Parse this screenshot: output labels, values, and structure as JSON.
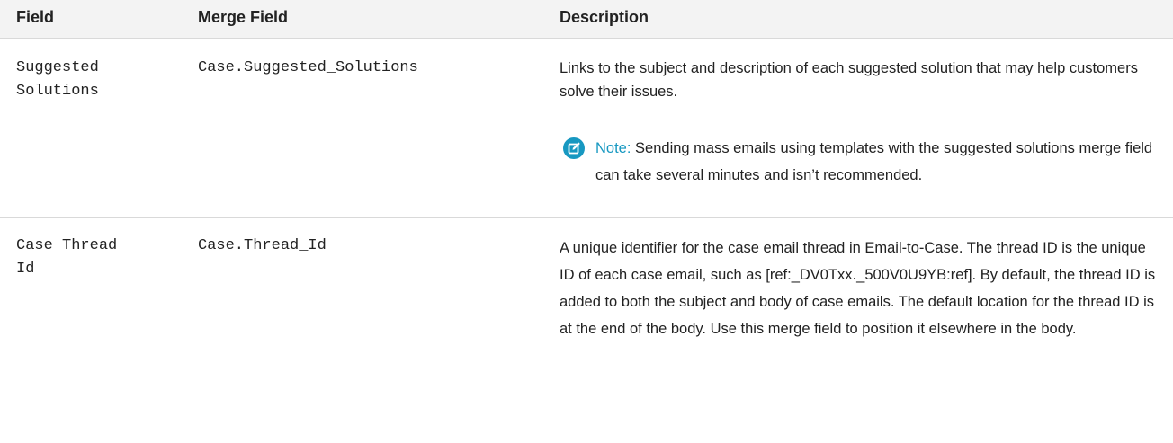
{
  "table": {
    "headers": {
      "field": "Field",
      "merge_field": "Merge Field",
      "description": "Description"
    },
    "rows": [
      {
        "field": "Suggested\nSolutions",
        "merge_field": "Case.Suggested_Solutions",
        "description": "Links to the subject and description of each suggested solution that may help customers solve their issues.",
        "note_label": "Note:",
        "note_text": "Sending mass emails using templates with the suggested solutions merge field can take several minutes and isn’t recommended."
      },
      {
        "field": "Case Thread\nId",
        "merge_field": "Case.Thread_Id",
        "description": "A unique identifier for the case email thread in Email-to-Case. The thread ID is the unique ID of each case email, such as [ref:_DV0Txx._500V0U9YB:ref]. By default, the thread ID is added to both the subject and body of case emails. The default location for the thread ID is at the end of the body. Use this merge field to position it elsewhere in the body."
      }
    ]
  },
  "colors": {
    "note_accent": "#1798c1",
    "header_background": "#f3f3f3"
  },
  "icons": {
    "note": "note-edit-icon"
  }
}
